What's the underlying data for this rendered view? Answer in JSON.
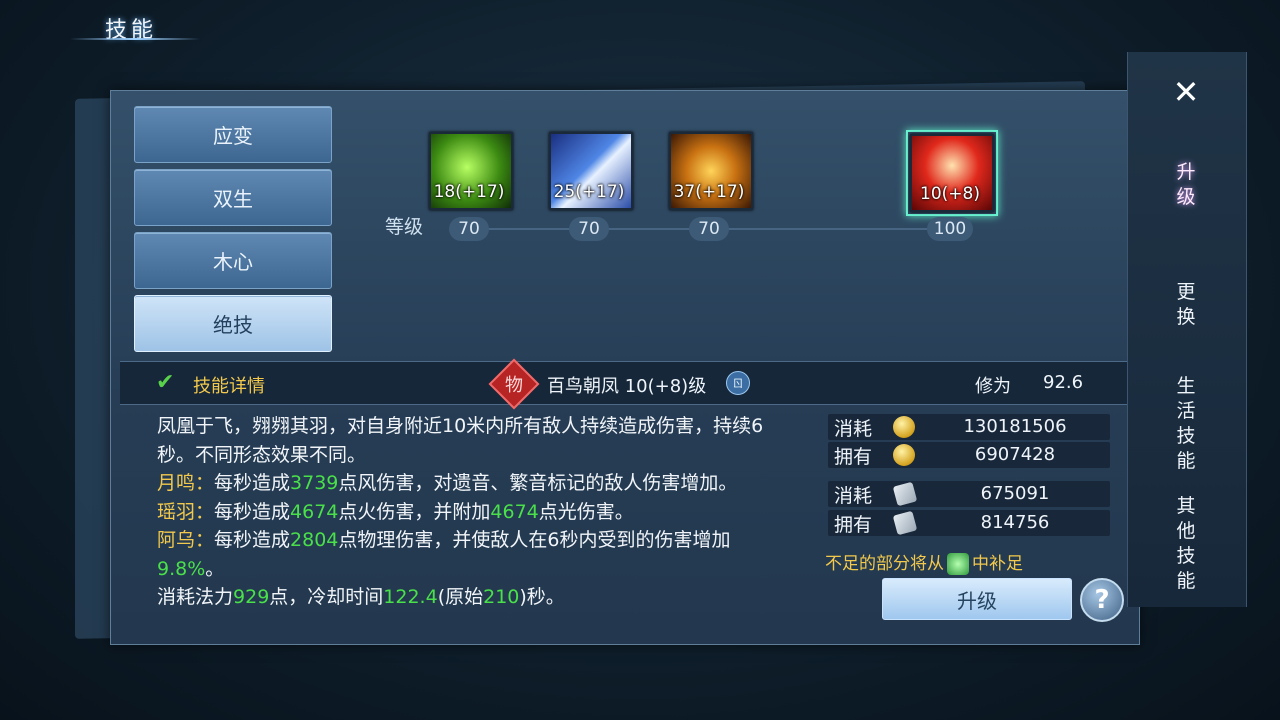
{
  "header": {
    "title": "技能"
  },
  "tabs": [
    {
      "label": "应变",
      "active": false
    },
    {
      "label": "双生",
      "active": false
    },
    {
      "label": "木心",
      "active": false
    },
    {
      "label": "绝技",
      "active": true
    }
  ],
  "skills": [
    {
      "icon": "green-leaf-skill-icon",
      "level_text": "18(+17)",
      "required_level": "70"
    },
    {
      "icon": "blue-arrow-skill-icon",
      "level_text": "25(+17)",
      "required_level": "70"
    },
    {
      "icon": "gold-swirl-skill-icon",
      "level_text": "37(+17)",
      "required_level": "70"
    },
    {
      "icon": "red-phoenix-skill-icon",
      "level_text": "10(+8)",
      "required_level": "100",
      "selected": true
    }
  ],
  "level_label": "等级",
  "info_bar": {
    "details_label": "技能详情",
    "badge_char": "物",
    "skill_name": "百鸟朝凤 10(+8)级",
    "cultivation_label": "修为",
    "cultivation_value": "92.6"
  },
  "description": {
    "intro": "凤凰于飞，翙翙其羽，对自身附近10米内所有敌人持续造成伤害，持续6秒。不同形态效果不同。",
    "yueming_label": "月鸣：",
    "yueming_pre": "每秒造成",
    "yueming_num": "3739",
    "yueming_post": "点风伤害，对遗音、繁音标记的敌人伤害增加。",
    "yaoyu_label": "瑶羽：",
    "yaoyu_pre": "每秒造成",
    "yaoyu_num1": "4674",
    "yaoyu_mid": "点火伤害，并附加",
    "yaoyu_num2": "4674",
    "yaoyu_post": "点光伤害。",
    "awu_label": "阿乌：",
    "awu_pre": "每秒造成",
    "awu_num": "2804",
    "awu_mid": "点物理伤害，并使敌人在6秒内受到的伤害增加",
    "awu_pct": "9.8%",
    "awu_post": "。",
    "mana_pre": "消耗法力",
    "mana_num": "929",
    "mana_mid": "点，冷却时间",
    "cd_num": "122.4",
    "cd_mid": "(原始",
    "cd_orig": "210",
    "cd_post": ")秒。"
  },
  "costs": [
    {
      "label": "消耗",
      "icon": "exp-coin-icon",
      "value": "130181506"
    },
    {
      "label": "拥有",
      "icon": "exp-coin-icon",
      "value": "6907428"
    },
    {
      "label": "消耗",
      "icon": "scroll-icon",
      "value": "675091"
    },
    {
      "label": "拥有",
      "icon": "scroll-icon",
      "value": "814756"
    }
  ],
  "supplement": {
    "pre": "不足的部分将从",
    "post": "中补足"
  },
  "upgrade_button": "升级",
  "help_button": "?",
  "right_menu": {
    "close": "✕",
    "items": [
      "升级",
      "更换",
      "生活技能",
      "其他技能"
    ]
  }
}
